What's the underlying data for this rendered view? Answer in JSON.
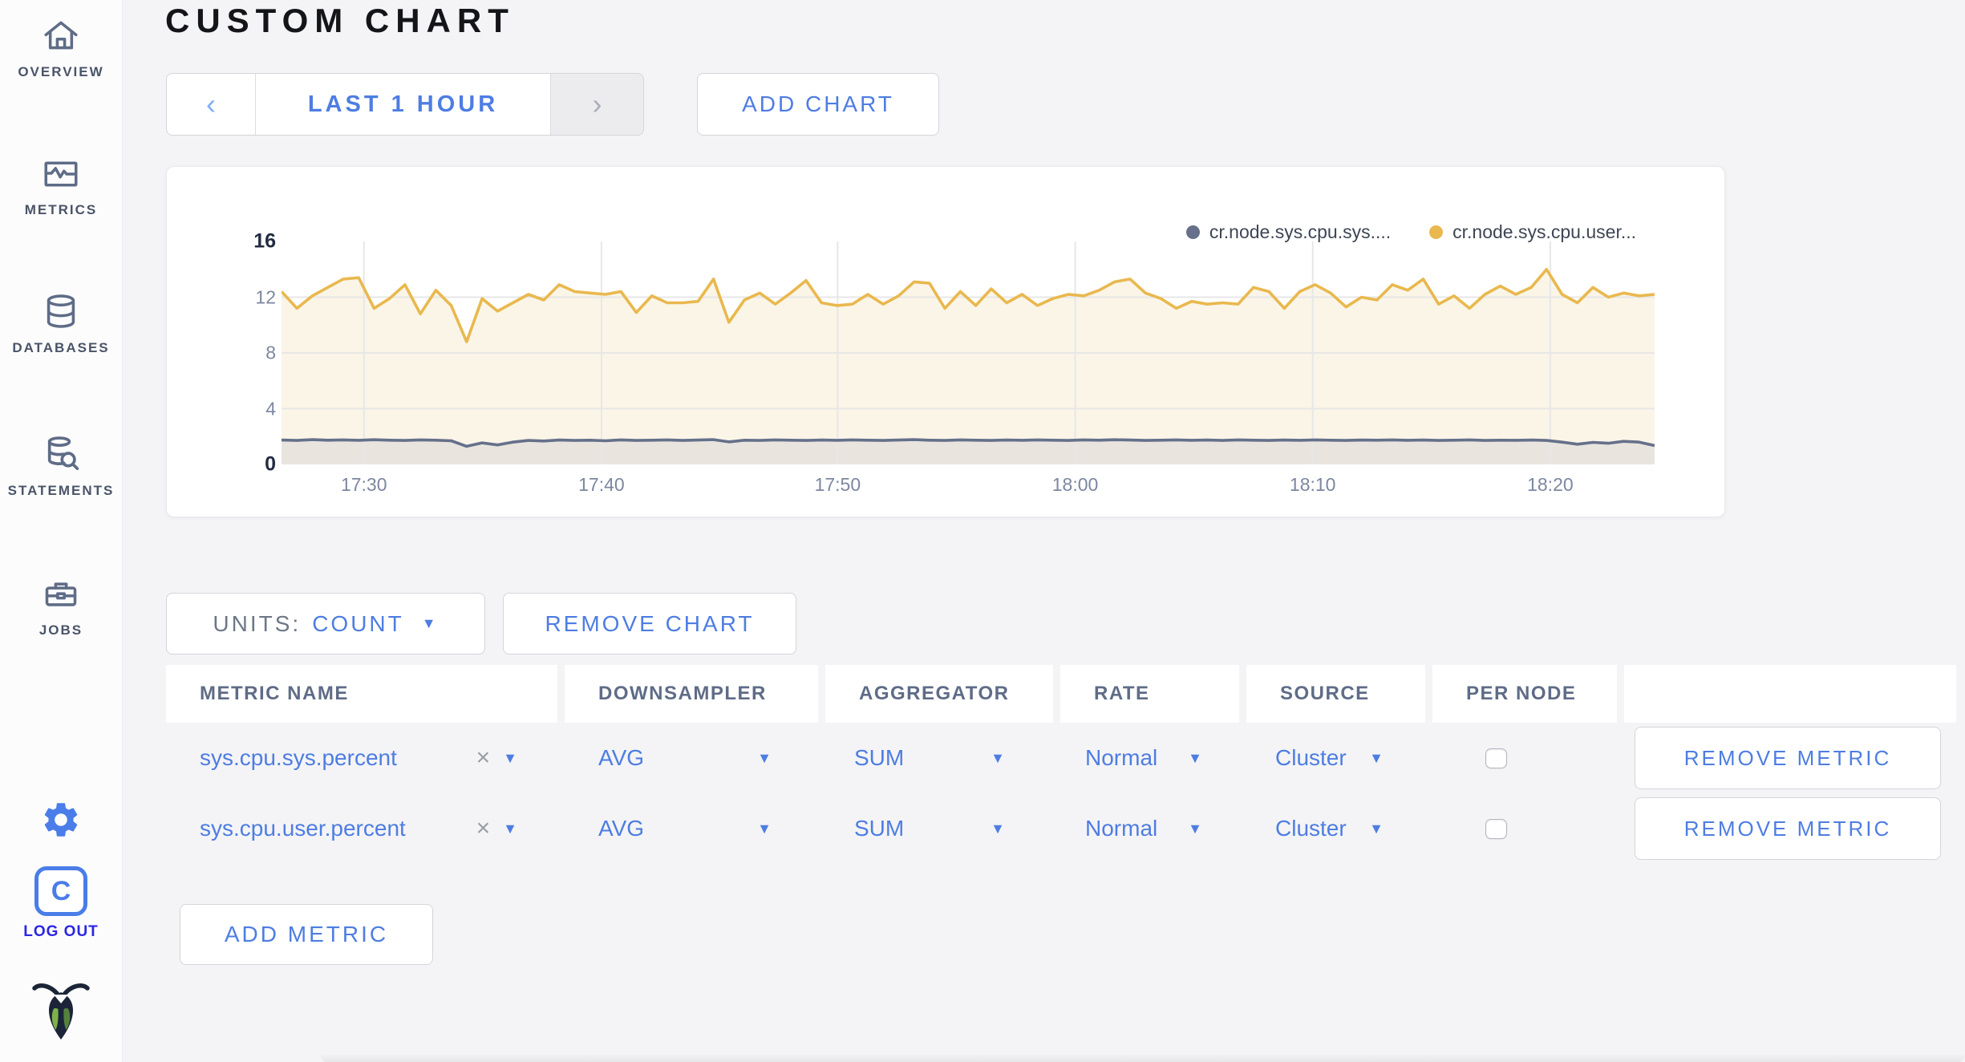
{
  "header": {
    "title": "CUSTOM CHART"
  },
  "icons": {
    "caret": "▼",
    "close": "×",
    "prev_chevron": "‹",
    "next_chevron": "›"
  },
  "sidebar": {
    "items": [
      {
        "label": "OVERVIEW"
      },
      {
        "label": "METRICS"
      },
      {
        "label": "DATABASES"
      },
      {
        "label": "STATEMENTS"
      },
      {
        "label": "JOBS"
      }
    ],
    "logo_letter": "C",
    "logout_label": "LOG OUT"
  },
  "toolbar": {
    "time_range_label": "LAST 1 HOUR",
    "add_chart_label": "ADD CHART"
  },
  "units_bar": {
    "units_label": "UNITS:",
    "units_value": "COUNT",
    "remove_chart_label": "REMOVE CHART"
  },
  "table": {
    "headers": [
      "METRIC NAME",
      "DOWNSAMPLER",
      "AGGREGATOR",
      "RATE",
      "SOURCE",
      "PER NODE",
      ""
    ],
    "rows": [
      {
        "name": "sys.cpu.sys.percent",
        "downsampler": "AVG",
        "aggregator": "SUM",
        "rate": "Normal",
        "source": "Cluster",
        "per_node_checked": false,
        "remove_label": "REMOVE METRIC"
      },
      {
        "name": "sys.cpu.user.percent",
        "downsampler": "AVG",
        "aggregator": "SUM",
        "rate": "Normal",
        "source": "Cluster",
        "per_node_checked": false,
        "remove_label": "REMOVE METRIC"
      }
    ],
    "add_metric_label": "ADD METRIC"
  },
  "colors": {
    "accent_blue": "#4E7DE2",
    "logout_blue": "#2A26E2",
    "slate": "#5F6C87",
    "page_bg": "#F4F4F6",
    "card_bg": "#FFFFFF",
    "grid": "#E7E7E7",
    "series_sys": "#66708B",
    "series_user": "#E9B84E"
  },
  "chart_data": {
    "type": "area",
    "title": "",
    "xlabel": "",
    "ylabel": "",
    "x_range": [
      "17:26",
      "18:24"
    ],
    "x_tick_labels": [
      "17:30",
      "17:40",
      "17:50",
      "18:00",
      "18:10",
      "18:20"
    ],
    "x_tick_fractions": [
      0.06,
      0.233,
      0.405,
      0.578,
      0.751,
      0.924
    ],
    "y_ticks": [
      16,
      12,
      8,
      4,
      0
    ],
    "y_strong_ticks": [
      16,
      0
    ],
    "y_gridlines": [
      12,
      8,
      4
    ],
    "ylim": [
      0,
      16
    ],
    "grid_color": "#E7E7E7",
    "legend_position": "top-right",
    "series": [
      {
        "name": "cr.node.sys.cpu.sys.percent",
        "legend_label": "cr.node.sys.cpu.sys....",
        "color": "#66708B",
        "fill": "#E9E5DE",
        "values": [
          1.75,
          1.72,
          1.78,
          1.74,
          1.76,
          1.73,
          1.77,
          1.74,
          1.72,
          1.76,
          1.74,
          1.7,
          1.3,
          1.55,
          1.4,
          1.6,
          1.72,
          1.68,
          1.75,
          1.72,
          1.74,
          1.7,
          1.76,
          1.72,
          1.74,
          1.76,
          1.72,
          1.75,
          1.78,
          1.62,
          1.74,
          1.72,
          1.76,
          1.74,
          1.72,
          1.75,
          1.73,
          1.76,
          1.74,
          1.72,
          1.75,
          1.78,
          1.74,
          1.72,
          1.76,
          1.74,
          1.72,
          1.75,
          1.73,
          1.76,
          1.74,
          1.72,
          1.76,
          1.74,
          1.77,
          1.75,
          1.72,
          1.74,
          1.76,
          1.73,
          1.75,
          1.72,
          1.76,
          1.74,
          1.72,
          1.75,
          1.73,
          1.76,
          1.74,
          1.72,
          1.75,
          1.74,
          1.76,
          1.73,
          1.75,
          1.72,
          1.74,
          1.76,
          1.72,
          1.74,
          1.73,
          1.75,
          1.72,
          1.6,
          1.45,
          1.58,
          1.52,
          1.66,
          1.6,
          1.35
        ]
      },
      {
        "name": "cr.node.sys.cpu.user.percent",
        "legend_label": "cr.node.sys.cpu.user...",
        "color": "#E9B84E",
        "fill": "#FAF5E7",
        "values": [
          12.4,
          11.2,
          12.1,
          12.7,
          13.3,
          13.4,
          11.2,
          11.9,
          12.9,
          10.8,
          12.5,
          11.4,
          8.8,
          11.9,
          11.0,
          11.6,
          12.2,
          11.8,
          12.9,
          12.4,
          12.3,
          12.2,
          12.4,
          10.9,
          12.1,
          11.6,
          11.6,
          11.7,
          13.3,
          10.2,
          11.8,
          12.3,
          11.5,
          12.3,
          13.2,
          11.6,
          11.4,
          11.5,
          12.2,
          11.5,
          12.1,
          13.1,
          13.0,
          11.2,
          12.4,
          11.4,
          12.6,
          11.6,
          12.2,
          11.4,
          11.9,
          12.2,
          12.1,
          12.5,
          13.1,
          13.3,
          12.3,
          11.9,
          11.2,
          11.7,
          11.5,
          11.6,
          11.5,
          12.7,
          12.4,
          11.2,
          12.4,
          12.9,
          12.3,
          11.3,
          12.0,
          11.8,
          12.9,
          12.5,
          13.3,
          11.5,
          12.1,
          11.2,
          12.2,
          12.8,
          12.2,
          12.7,
          14.0,
          12.2,
          11.6,
          12.7,
          12.0,
          12.3,
          12.1,
          12.2
        ]
      }
    ]
  }
}
